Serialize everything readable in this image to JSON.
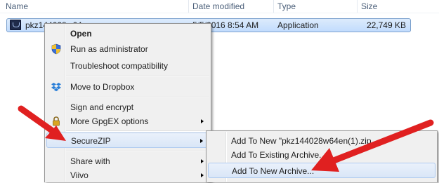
{
  "columns": [
    "Name",
    "Date modified",
    "Type",
    "Size"
  ],
  "file": {
    "name": "pkz144028w64",
    "date": "5/5/2016 8:54 AM",
    "type": "Application",
    "size": "22,749 KB"
  },
  "context_menu": {
    "open": "Open",
    "run_as_admin": "Run as administrator",
    "troubleshoot": "Troubleshoot compatibility",
    "move_dropbox": "Move to Dropbox",
    "sign_encrypt": "Sign and encrypt",
    "gpgex": "More GpgEX options",
    "securezip": "SecureZIP",
    "share_with": "Share with",
    "viivo": "Viivo"
  },
  "submenu": {
    "add_new_named": "Add To New \"pkz144028w64en(1).zip",
    "add_existing": "Add To Existing Archive...",
    "add_new_archive": "Add To New Archive..."
  },
  "colors": {
    "selection": "#cce0fc",
    "menu_bg": "#f0f0f0",
    "arrow_red": "#e02020"
  }
}
